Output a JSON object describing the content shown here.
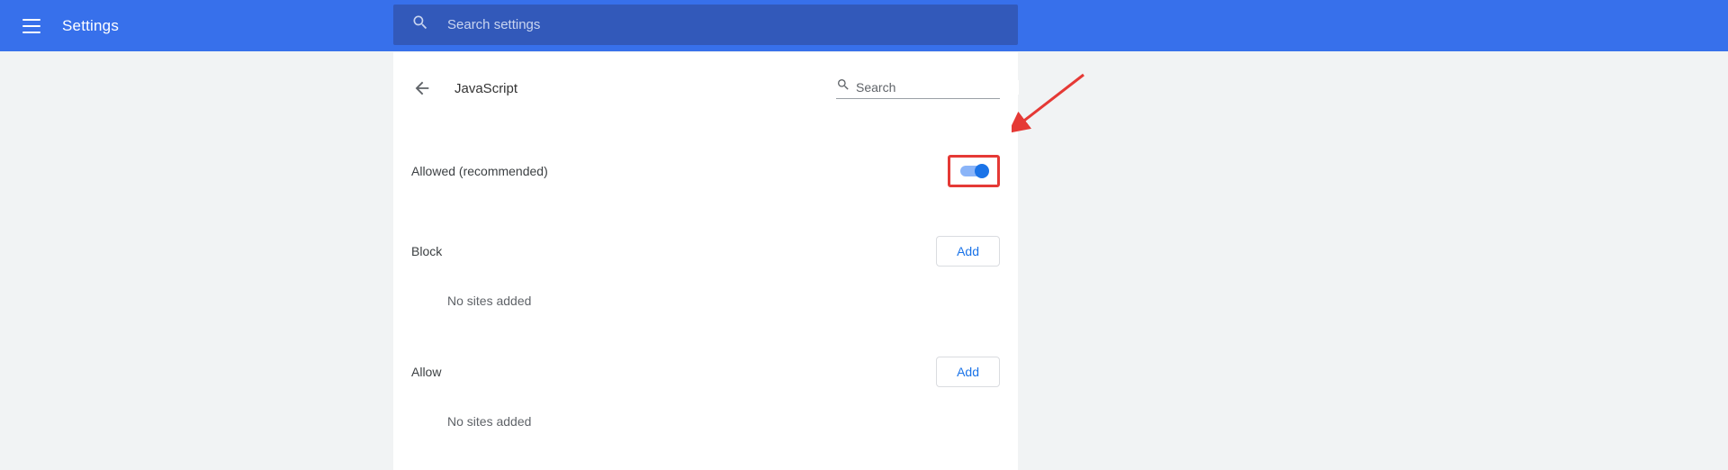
{
  "topbar": {
    "title": "Settings",
    "search_placeholder": "Search settings"
  },
  "page": {
    "title": "JavaScript",
    "mini_search_placeholder": "Search"
  },
  "toggle_row": {
    "label": "Allowed (recommended)",
    "state": "on"
  },
  "sections": {
    "block": {
      "title": "Block",
      "add_label": "Add",
      "empty": "No sites added"
    },
    "allow": {
      "title": "Allow",
      "add_label": "Add",
      "empty": "No sites added"
    }
  },
  "annotation": {
    "type": "arrow-highlight",
    "target": "javascript-allowed-toggle",
    "highlight_color": "#e53935"
  }
}
